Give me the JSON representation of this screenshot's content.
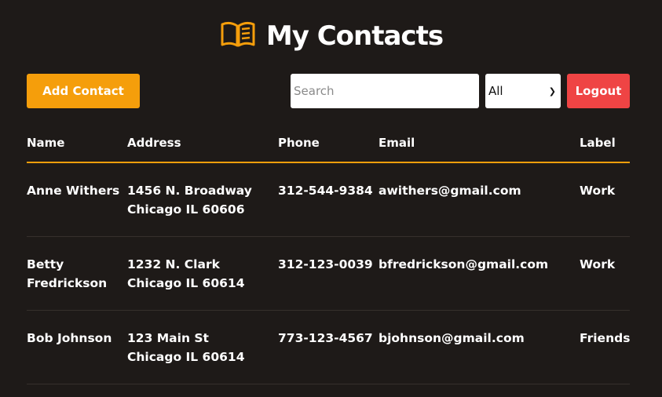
{
  "header": {
    "title": "My Contacts",
    "icon": "book-open-icon",
    "accent": "#f59e0b"
  },
  "toolbar": {
    "add_label": "Add Contact",
    "search_placeholder": "Search",
    "search_value": "",
    "filter_selected": "All",
    "logout_label": "Logout"
  },
  "colors": {
    "background": "#1e1a18",
    "add": "#f59e0b",
    "logout": "#ef4444"
  },
  "table": {
    "columns": [
      "Name",
      "Address",
      "Phone",
      "Email",
      "Label"
    ],
    "rows": [
      {
        "name": [
          "Anne Withers"
        ],
        "address": [
          "1456 N. Broadway",
          "Chicago IL 60606"
        ],
        "phone": "312-544-9384",
        "email": "awithers@gmail.com",
        "label": "Work"
      },
      {
        "name": [
          "Betty",
          "Fredrickson"
        ],
        "address": [
          "1232 N. Clark",
          "Chicago IL 60614"
        ],
        "phone": "312-123-0039",
        "email": "bfredrickson@gmail.com",
        "label": "Work"
      },
      {
        "name": [
          "Bob Johnson"
        ],
        "address": [
          "123 Main St",
          "Chicago IL 60614"
        ],
        "phone": "773-123-4567",
        "email": "bjohnson@gmail.com",
        "label": "Friends"
      }
    ]
  }
}
